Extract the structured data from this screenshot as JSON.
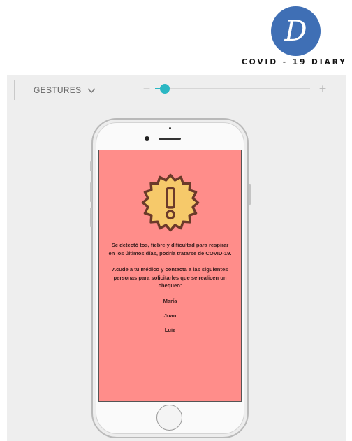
{
  "logo": {
    "letter": "D",
    "text": "COVID - 19 DIARY",
    "color": "#3f6fb5"
  },
  "toolbar": {
    "gestures_label": "GESTURES",
    "zoom_minus": "−",
    "zoom_plus": "+",
    "zoom_level": 0.03,
    "accent": "#2bb7c3"
  },
  "screen": {
    "background": "#ff8d8a",
    "icon": "alert-badge-icon",
    "message_1": "Se detectó tos, fiebre y dificultad para respirar en los últimos días, podría tratarse de COVID-19.",
    "message_2": "Acude a tu médico y contacta a las siguientes personas para solicitarles que se realicen un chequeo:",
    "contacts": [
      "María",
      "Juan",
      "Luis"
    ]
  }
}
